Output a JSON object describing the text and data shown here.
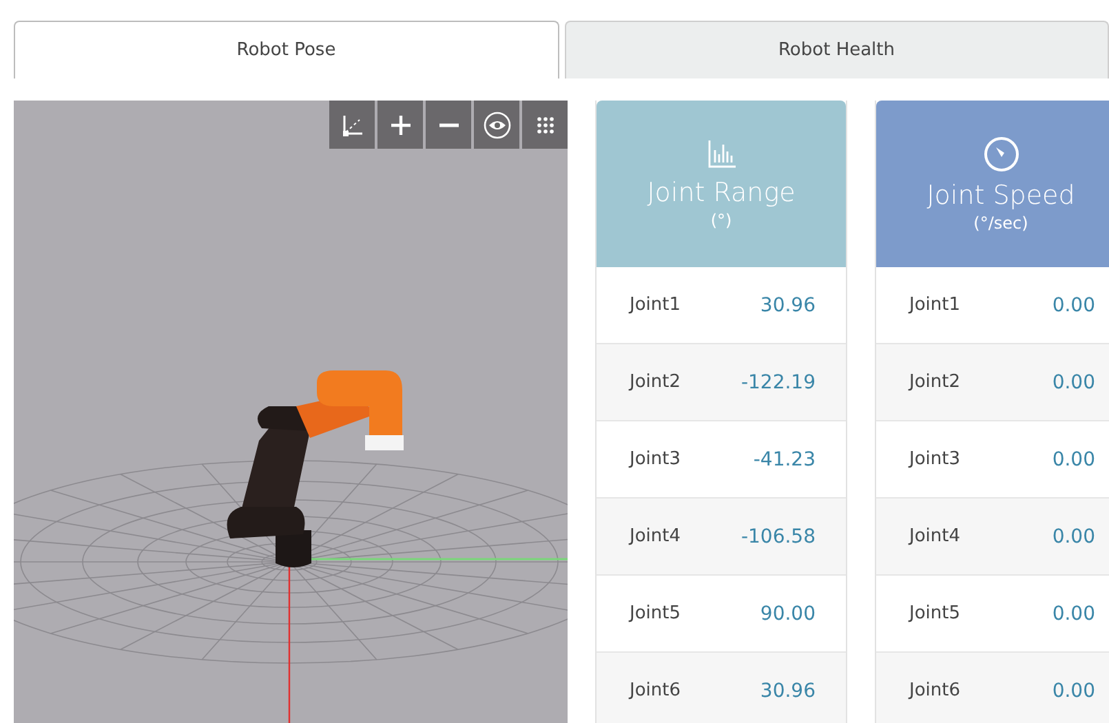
{
  "tabs": [
    {
      "label": "Robot Pose",
      "selected": true
    },
    {
      "label": "Robot Health",
      "selected": false
    }
  ],
  "viewer_toolbar": [
    {
      "kind": "axes"
    },
    {
      "kind": "zoom-in"
    },
    {
      "kind": "zoom-out"
    },
    {
      "kind": "view"
    },
    {
      "kind": "grid"
    }
  ],
  "panels": [
    {
      "kind": "range",
      "title": "Joint Range",
      "unit": "(°)",
      "color": "#9fc6d2",
      "rows": [
        {
          "label": "Joint1",
          "value": "30.96"
        },
        {
          "label": "Joint2",
          "value": "-122.19"
        },
        {
          "label": "Joint3",
          "value": "-41.23"
        },
        {
          "label": "Joint4",
          "value": "-106.58"
        },
        {
          "label": "Joint5",
          "value": "90.00"
        },
        {
          "label": "Joint6",
          "value": "30.96"
        }
      ]
    },
    {
      "kind": "speed",
      "title": "Joint Speed",
      "unit": "(°/sec)",
      "color": "#7d9bcb",
      "rows": [
        {
          "label": "Joint1",
          "value": "0.00"
        },
        {
          "label": "Joint2",
          "value": "0.00"
        },
        {
          "label": "Joint3",
          "value": "0.00"
        },
        {
          "label": "Joint4",
          "value": "0.00"
        },
        {
          "label": "Joint5",
          "value": "0.00"
        },
        {
          "label": "Joint6",
          "value": "0.00"
        }
      ]
    }
  ]
}
